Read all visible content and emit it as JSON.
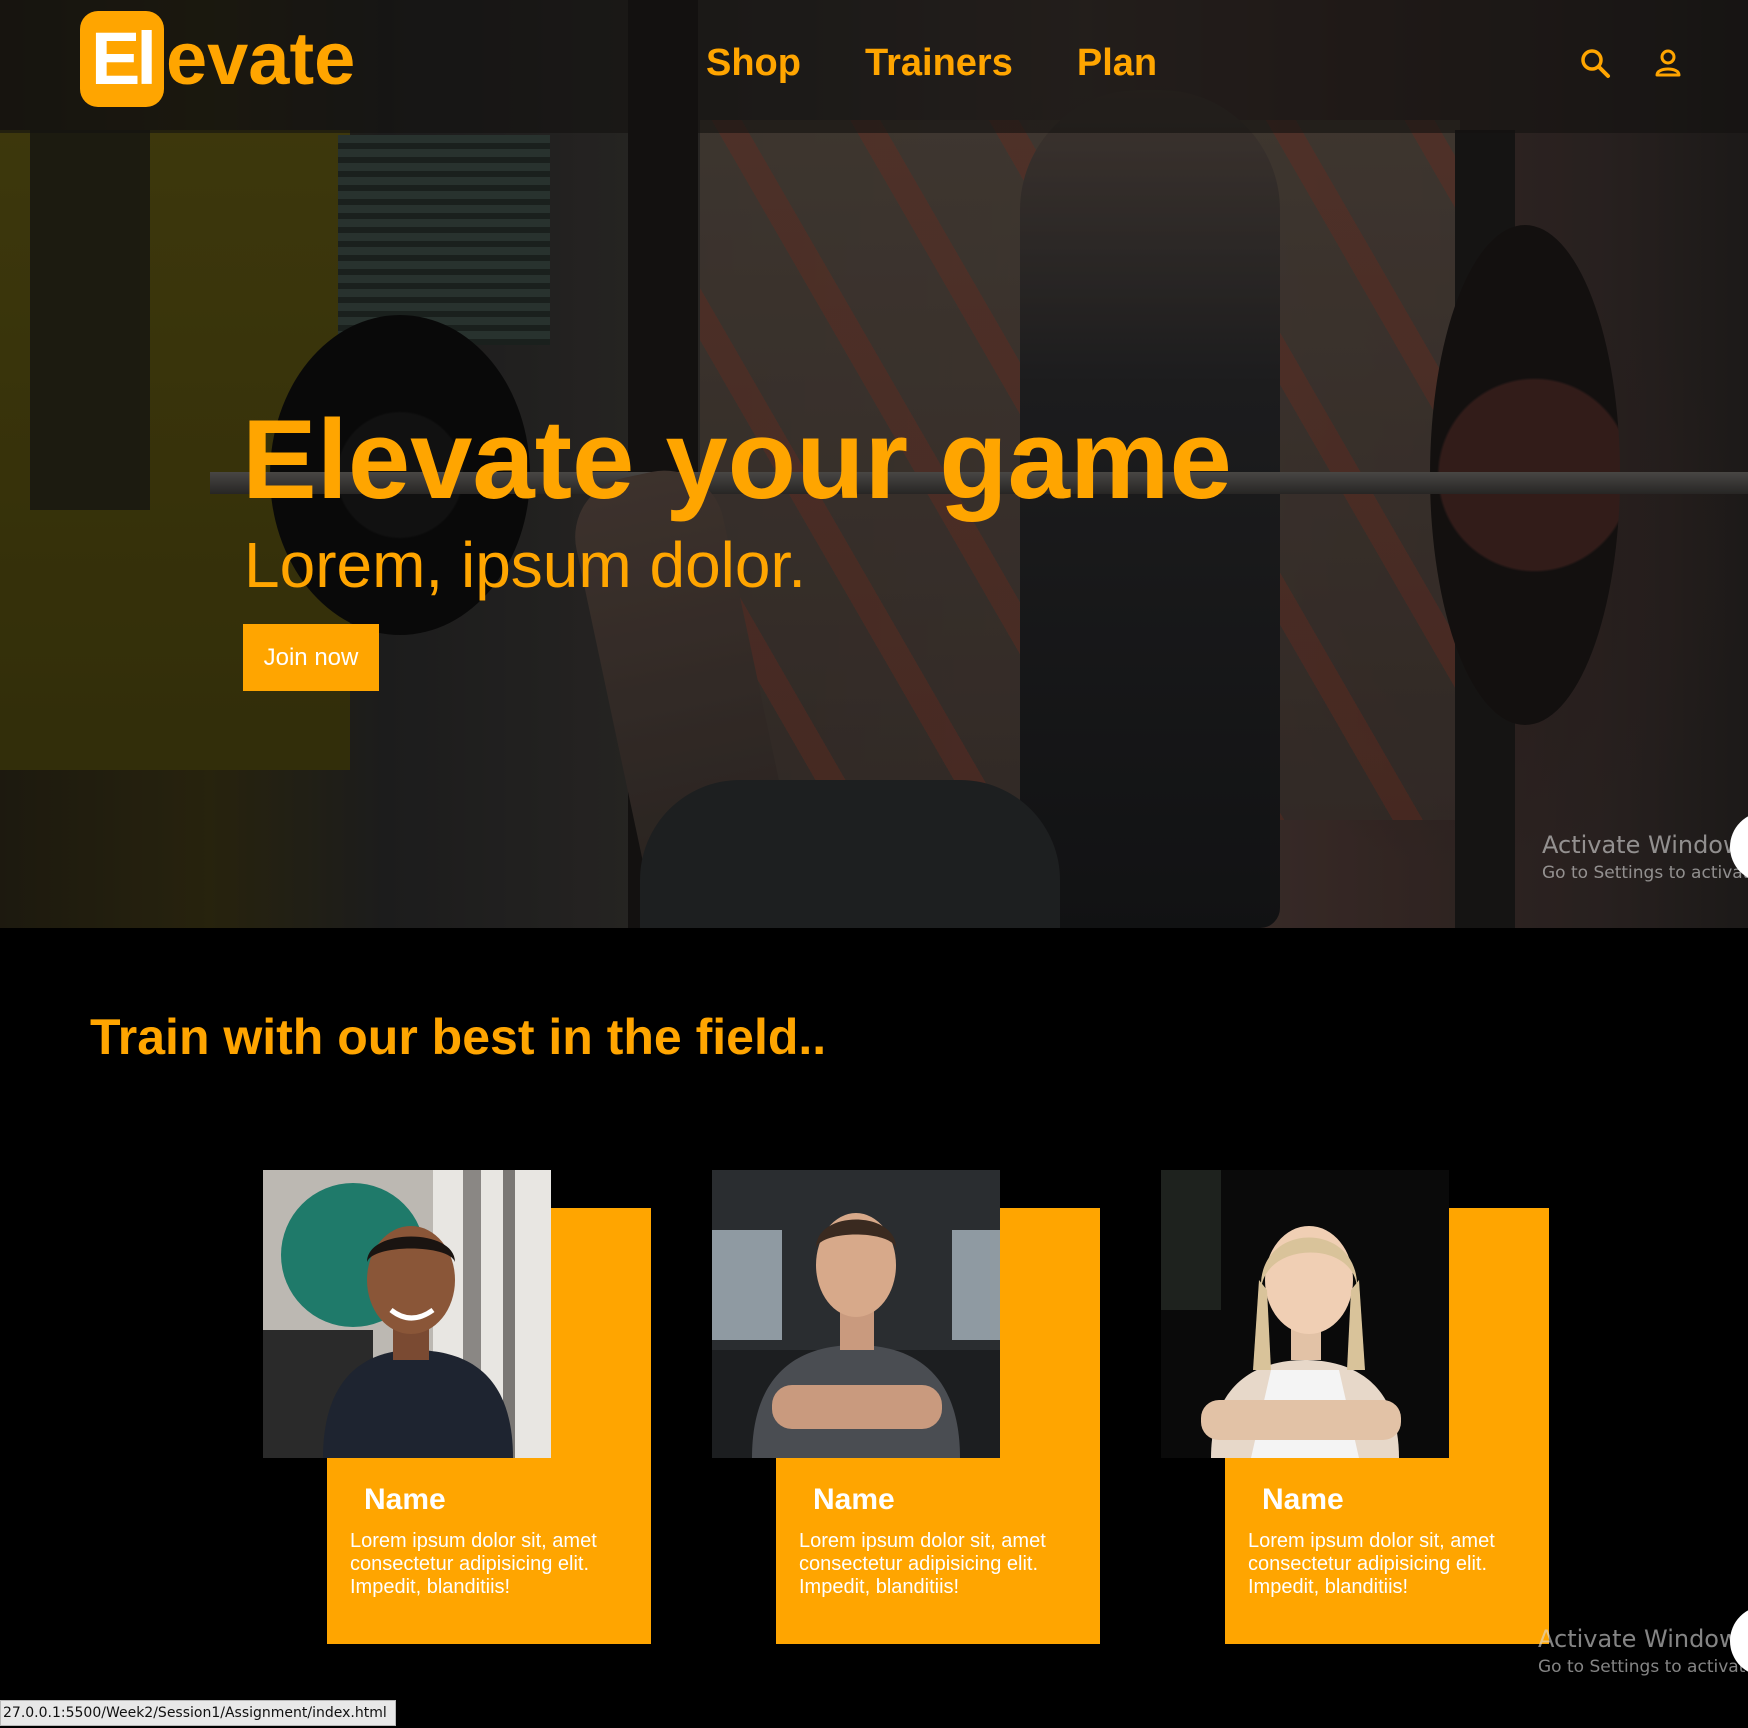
{
  "brand": {
    "logo_box_text": "El",
    "logo_rest_text": "evate",
    "accent_color": "#ffa500"
  },
  "nav": {
    "links": [
      "Shop",
      "Trainers",
      "Plan"
    ],
    "icons": [
      "search-icon",
      "user-icon"
    ]
  },
  "hero": {
    "title": "Elevate your game",
    "subtitle": "Lorem, ipsum dolor.",
    "cta_label": "Join now"
  },
  "trainers_section": {
    "title": "Train with our best in the field..",
    "cards": [
      {
        "name": "Name",
        "description": "Lorem ipsum dolor sit, amet consectetur adipisicing elit. Impedit, blanditiis!"
      },
      {
        "name": "Name",
        "description": "Lorem ipsum dolor sit, amet consectetur adipisicing elit. Impedit, blanditiis!"
      },
      {
        "name": "Name",
        "description": "Lorem ipsum dolor sit, amet consectetur adipisicing elit. Impedit, blanditiis!"
      }
    ]
  },
  "os_overlay": {
    "watermark_title": "Activate Windows",
    "watermark_subtitle": "Go to Settings to activate"
  },
  "status_bar": {
    "url": "27.0.0.1:5500/Week2/Session1/Assignment/index.html"
  }
}
